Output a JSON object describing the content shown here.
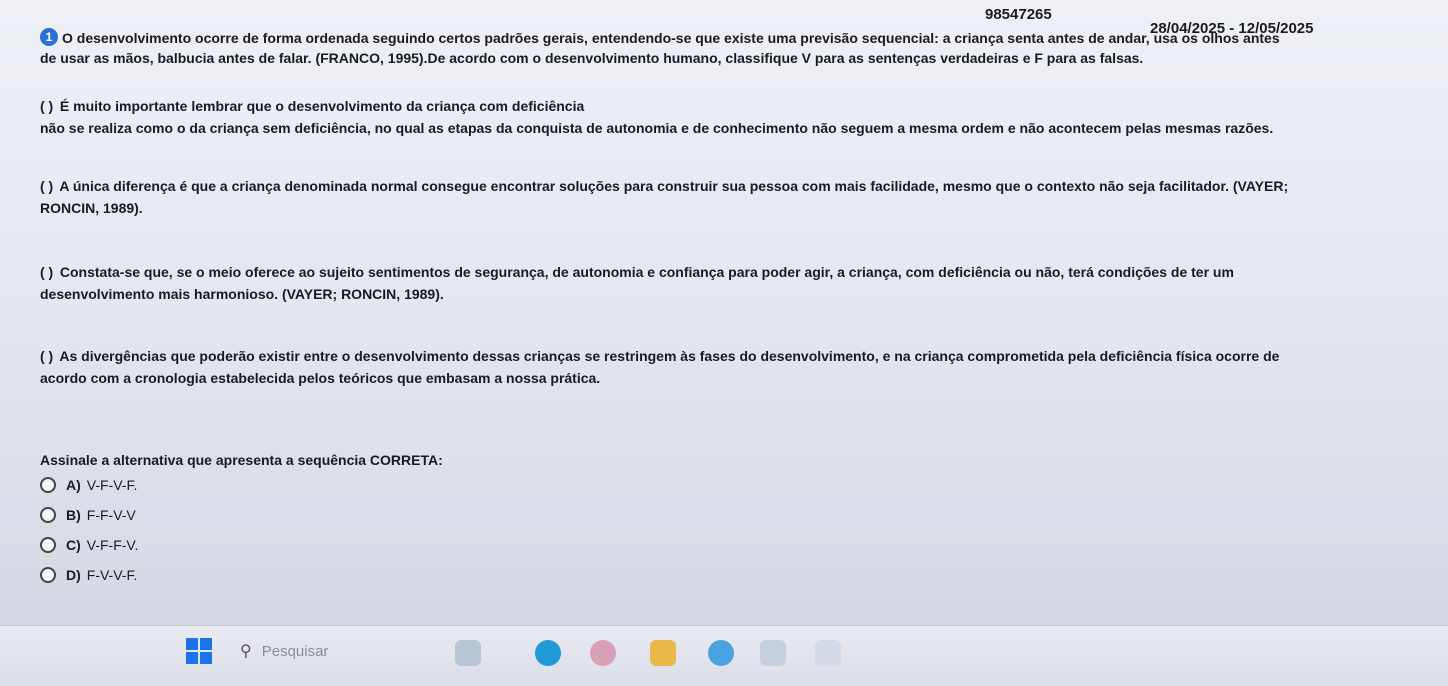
{
  "header": {
    "code": "98547265",
    "dates": "28/04/2025 - 12/05/2025"
  },
  "question": {
    "number": "1",
    "intro_line1": "O desenvolvimento ocorre de forma ordenada seguindo certos padrões gerais, entendendo-se que existe uma previsão sequencial: a criança senta antes de andar, usa os olhos antes",
    "intro_line2": "de usar as mãos, balbucia antes de falar. (FRANCO, 1995).De acordo com o desenvolvimento humano, classifique V para as sentenças verdadeiras e F para as falsas.",
    "statements": [
      {
        "paren": "( )",
        "line1": "É muito importante lembrar que o desenvolvimento da criança com deficiência",
        "line2": "não se realiza como o da criança sem deficiência, no qual as etapas da conquista de autonomia e de conhecimento não seguem a mesma ordem e não acontecem pelas mesmas razões."
      },
      {
        "paren": "( )",
        "line1": "A única diferença é que a criança denominada normal consegue encontrar soluções para construir sua pessoa com mais facilidade, mesmo que o contexto não seja facilitador. (VAYER;",
        "line2": "RONCIN, 1989)."
      },
      {
        "paren": "( )",
        "line1": "Constata-se que, se o meio oferece ao sujeito sentimentos de segurança, de autonomia e confiança para poder agir, a criança, com deficiência ou não, terá condições de ter um",
        "line2": "desenvolvimento mais harmonioso. (VAYER; RONCIN, 1989)."
      },
      {
        "paren": "( )",
        "line1": "As divergências que poderão existir entre o desenvolvimento dessas crianças se restringem às fases do desenvolvimento, e na criança comprometida pela deficiência física ocorre de",
        "line2": "acordo com a cronologia estabelecida pelos teóricos que embasam a nossa prática."
      }
    ],
    "prompt": "Assinale a alternativa que apresenta a sequência CORRETA:",
    "options": [
      {
        "letter": "A)",
        "text": "V-F-V-F."
      },
      {
        "letter": "B)",
        "text": "F-F-V-V"
      },
      {
        "letter": "C)",
        "text": "V-F-F-V."
      },
      {
        "letter": "D)",
        "text": "F-V-V-F."
      }
    ]
  },
  "taskbar": {
    "search_placeholder": "Pesquisar"
  },
  "colors": {
    "accent": "#2d6fd4",
    "windows_blue": "#1a73e8"
  }
}
